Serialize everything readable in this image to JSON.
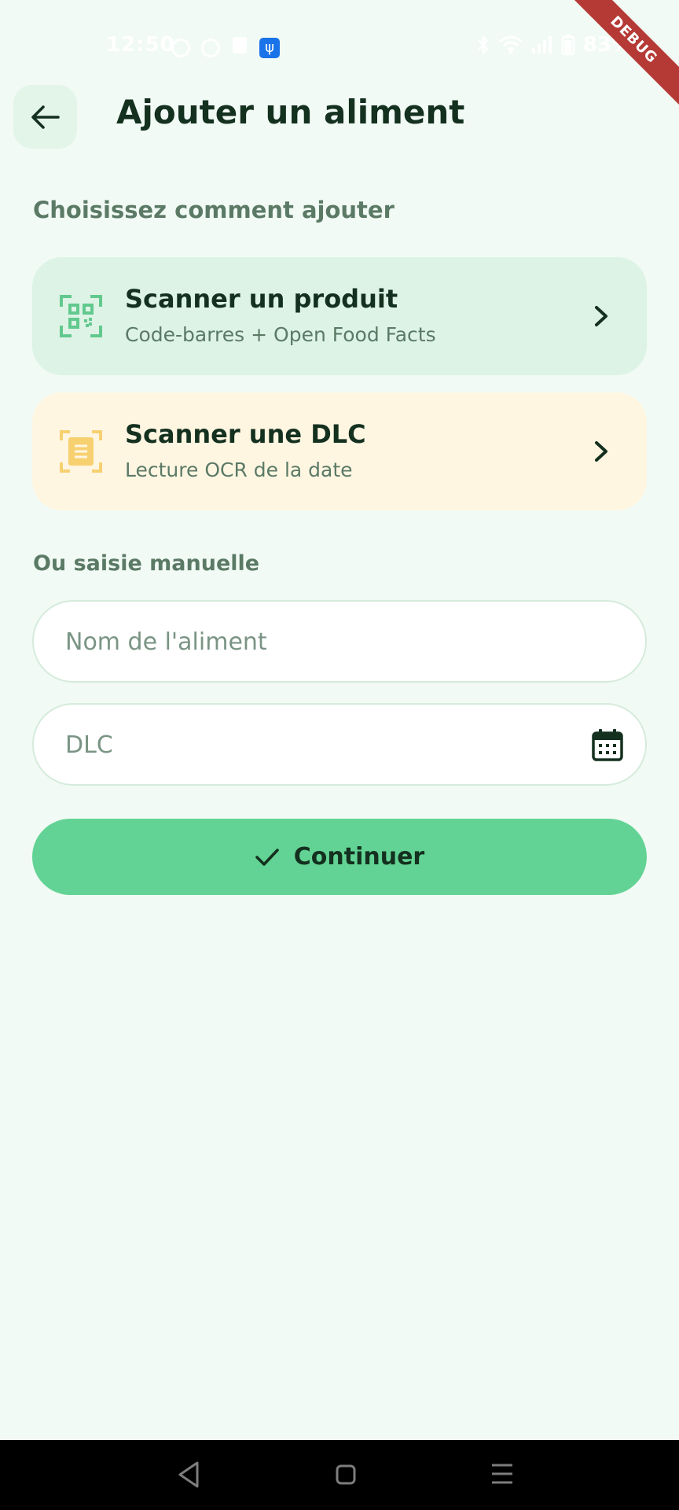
{
  "status_bar": {
    "time": "12:50",
    "battery": "83%",
    "debug_label": "DEBUG"
  },
  "app_bar": {
    "title": "Ajouter un aliment"
  },
  "choose_section": {
    "label": "Choisissez comment ajouter"
  },
  "options": [
    {
      "title": "Scanner un produit",
      "subtitle": "Code-barres + Open Food Facts",
      "icon": "qr-scan-icon",
      "color": "#dcf3e5",
      "icon_color": "#62c98e"
    },
    {
      "title": "Scanner une DLC",
      "subtitle": "Lecture OCR de la date",
      "icon": "document-scan-icon",
      "color": "#fff6e2",
      "icon_color": "#f7d070"
    }
  ],
  "manual_section": {
    "label": "Ou saisie manuelle",
    "name_field": {
      "placeholder": "Nom de l'aliment",
      "value": ""
    },
    "date_field": {
      "placeholder": "DLC",
      "value": "",
      "icon": "calendar-icon"
    }
  },
  "submit": {
    "label": "Continuer",
    "icon": "check-icon",
    "color": "#62d394"
  },
  "colors": {
    "background": "#f1faf4",
    "text_primary": "#14301f",
    "text_secondary": "#5b7a66"
  }
}
